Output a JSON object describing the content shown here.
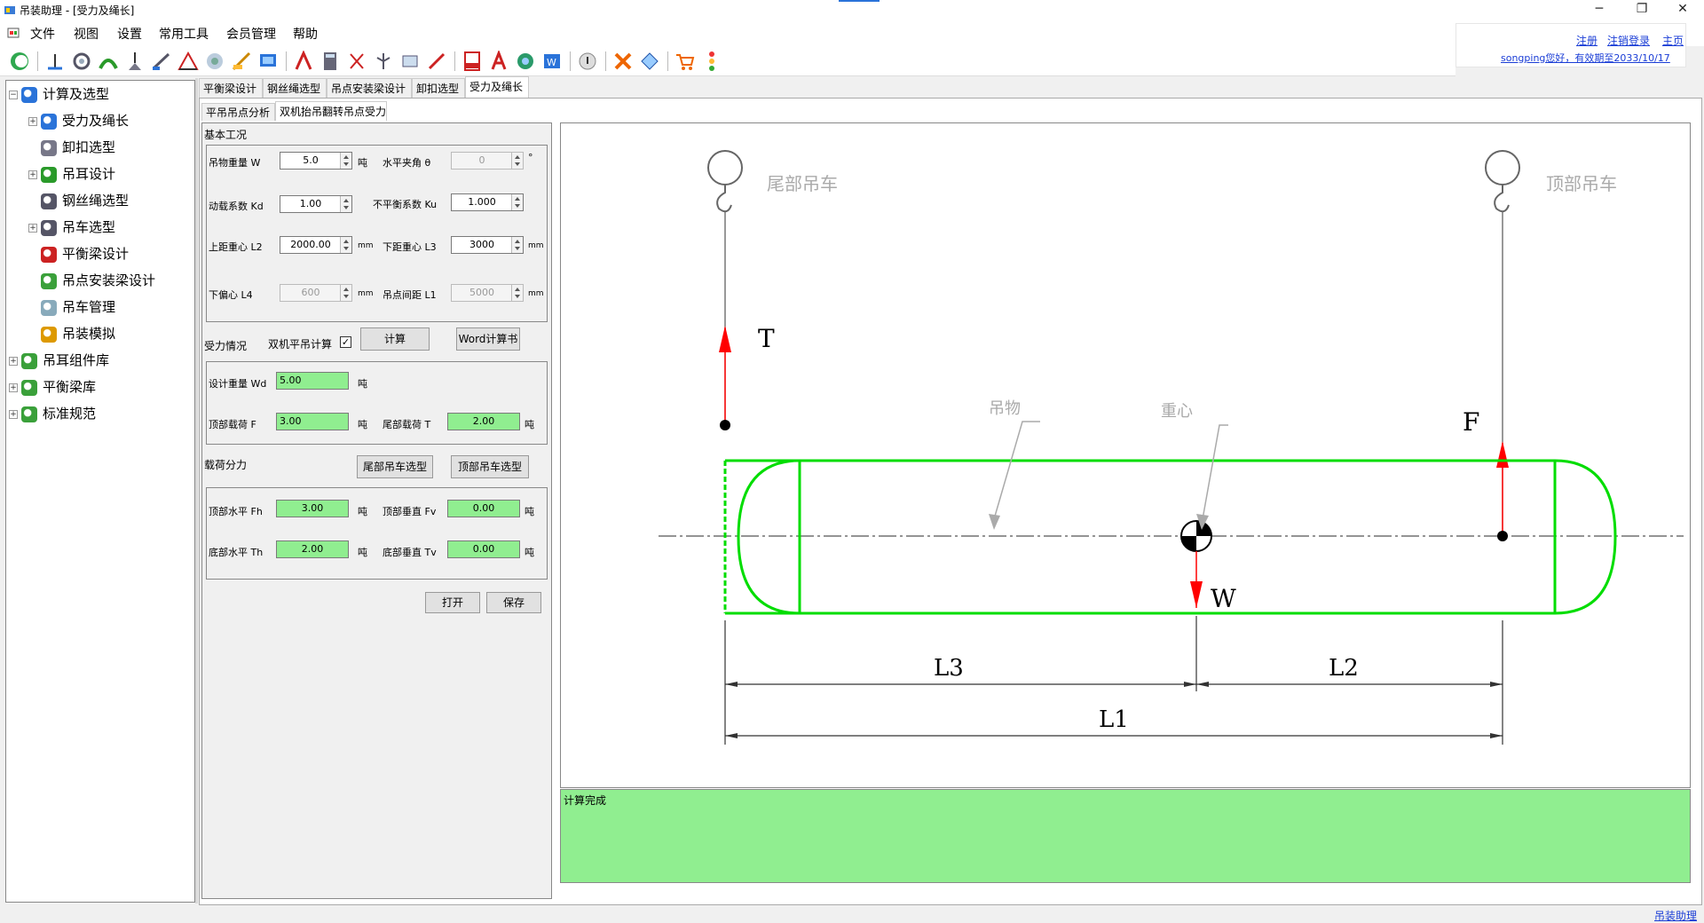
{
  "window": {
    "title": "吊装助理 - [受力及绳长]"
  },
  "menu": [
    "文件",
    "视图",
    "设置",
    "常用工具",
    "会员管理",
    "帮助"
  ],
  "top_links": {
    "register": "注册",
    "logout": "注销登录",
    "home": "主页",
    "welcome": "songping您好，有效期至2033/10/17"
  },
  "tree": [
    {
      "label": "计算及选型",
      "level": 0,
      "expander": "−",
      "icon": "globe-icon"
    },
    {
      "label": "受力及绳长",
      "level": 1,
      "expander": "+",
      "icon": "force-icon"
    },
    {
      "label": "卸扣选型",
      "level": 1,
      "expander": "",
      "icon": "shackle-icon"
    },
    {
      "label": "吊耳设计",
      "level": 1,
      "expander": "+",
      "icon": "lug-icon"
    },
    {
      "label": "钢丝绳选型",
      "level": 1,
      "expander": "",
      "icon": "rope-icon"
    },
    {
      "label": "吊车选型",
      "level": 1,
      "expander": "+",
      "icon": "crane-icon"
    },
    {
      "label": "平衡梁设计",
      "level": 1,
      "expander": "",
      "icon": "beam-icon"
    },
    {
      "label": "吊点安装梁设计",
      "level": 1,
      "expander": "",
      "icon": "puzzle-icon"
    },
    {
      "label": "吊车管理",
      "level": 1,
      "expander": "",
      "icon": "manage-icon"
    },
    {
      "label": "吊装模拟",
      "level": 1,
      "expander": "",
      "icon": "simulate-icon"
    },
    {
      "label": "吊耳组件库",
      "level": 0,
      "expander": "+",
      "icon": "puzzle-icon"
    },
    {
      "label": "平衡梁库",
      "level": 0,
      "expander": "+",
      "icon": "puzzle-icon"
    },
    {
      "label": "标准规范",
      "level": 0,
      "expander": "+",
      "icon": "puzzle-icon"
    }
  ],
  "tabs1": [
    "平衡梁设计",
    "钢丝绳选型",
    "吊点安装梁设计",
    "卸扣选型",
    "受力及绳长"
  ],
  "tabs2": [
    "平吊吊点分析",
    "双机抬吊翻转吊点受力"
  ],
  "basic": {
    "title": "基本工况",
    "weight": {
      "label": "吊物重量 W",
      "value": "5.0",
      "unit": "吨"
    },
    "angle": {
      "label": "水平夹角 θ",
      "value": "0",
      "unit": "°"
    },
    "kd": {
      "label": "动载系数 Kd",
      "value": "1.00"
    },
    "ku": {
      "label": "不平衡系数 Ku",
      "value": "1.000"
    },
    "l2": {
      "label": "上距重心 L2",
      "value": "2000.00",
      "unit": "mm"
    },
    "l3": {
      "label": "下距重心 L3",
      "value": "3000",
      "unit": "mm"
    },
    "l4": {
      "label": "下偏心 L4",
      "value": "600",
      "unit": "mm"
    },
    "l1": {
      "label": "吊点间距 L1",
      "value": "5000",
      "unit": "mm"
    }
  },
  "force": {
    "title": "受力情况",
    "dual_label": "双机平吊计算",
    "dual_checked": "✓",
    "calc_btn": "计算",
    "word_btn": "Word计算书",
    "wd": {
      "label": "设计重量 Wd",
      "value": "5.00",
      "unit": "吨"
    },
    "f": {
      "label": "顶部载荷 F",
      "value": "3.00",
      "unit": "吨"
    },
    "t": {
      "label": "尾部载荷 T",
      "value": "2.00",
      "unit": "吨"
    }
  },
  "split": {
    "title": "载荷分力",
    "tail_btn": "尾部吊车选型",
    "top_btn": "顶部吊车选型",
    "fh": {
      "label": "顶部水平 Fh",
      "value": "3.00",
      "unit": "吨"
    },
    "fv": {
      "label": "顶部垂直 Fv",
      "value": "0.00",
      "unit": "吨"
    },
    "th": {
      "label": "底部水平 Th",
      "value": "2.00",
      "unit": "吨"
    },
    "tv": {
      "label": "底部垂直 Tv",
      "value": "0.00",
      "unit": "吨"
    }
  },
  "actions": {
    "open": "打开",
    "save": "保存"
  },
  "diagram": {
    "tail_crane": "尾部吊车",
    "top_crane": "顶部吊车",
    "T": "T",
    "F": "F",
    "W": "W",
    "object": "吊物",
    "cog": "重心",
    "L1": "L1",
    "L2": "L2",
    "L3": "L3"
  },
  "status": "计算完成",
  "bottom_link": "吊装助理",
  "colors": {
    "green_field": "#90ee90",
    "vessel": "#00dd00",
    "arrow": "#ff0000",
    "link": "#1a3dd6"
  }
}
